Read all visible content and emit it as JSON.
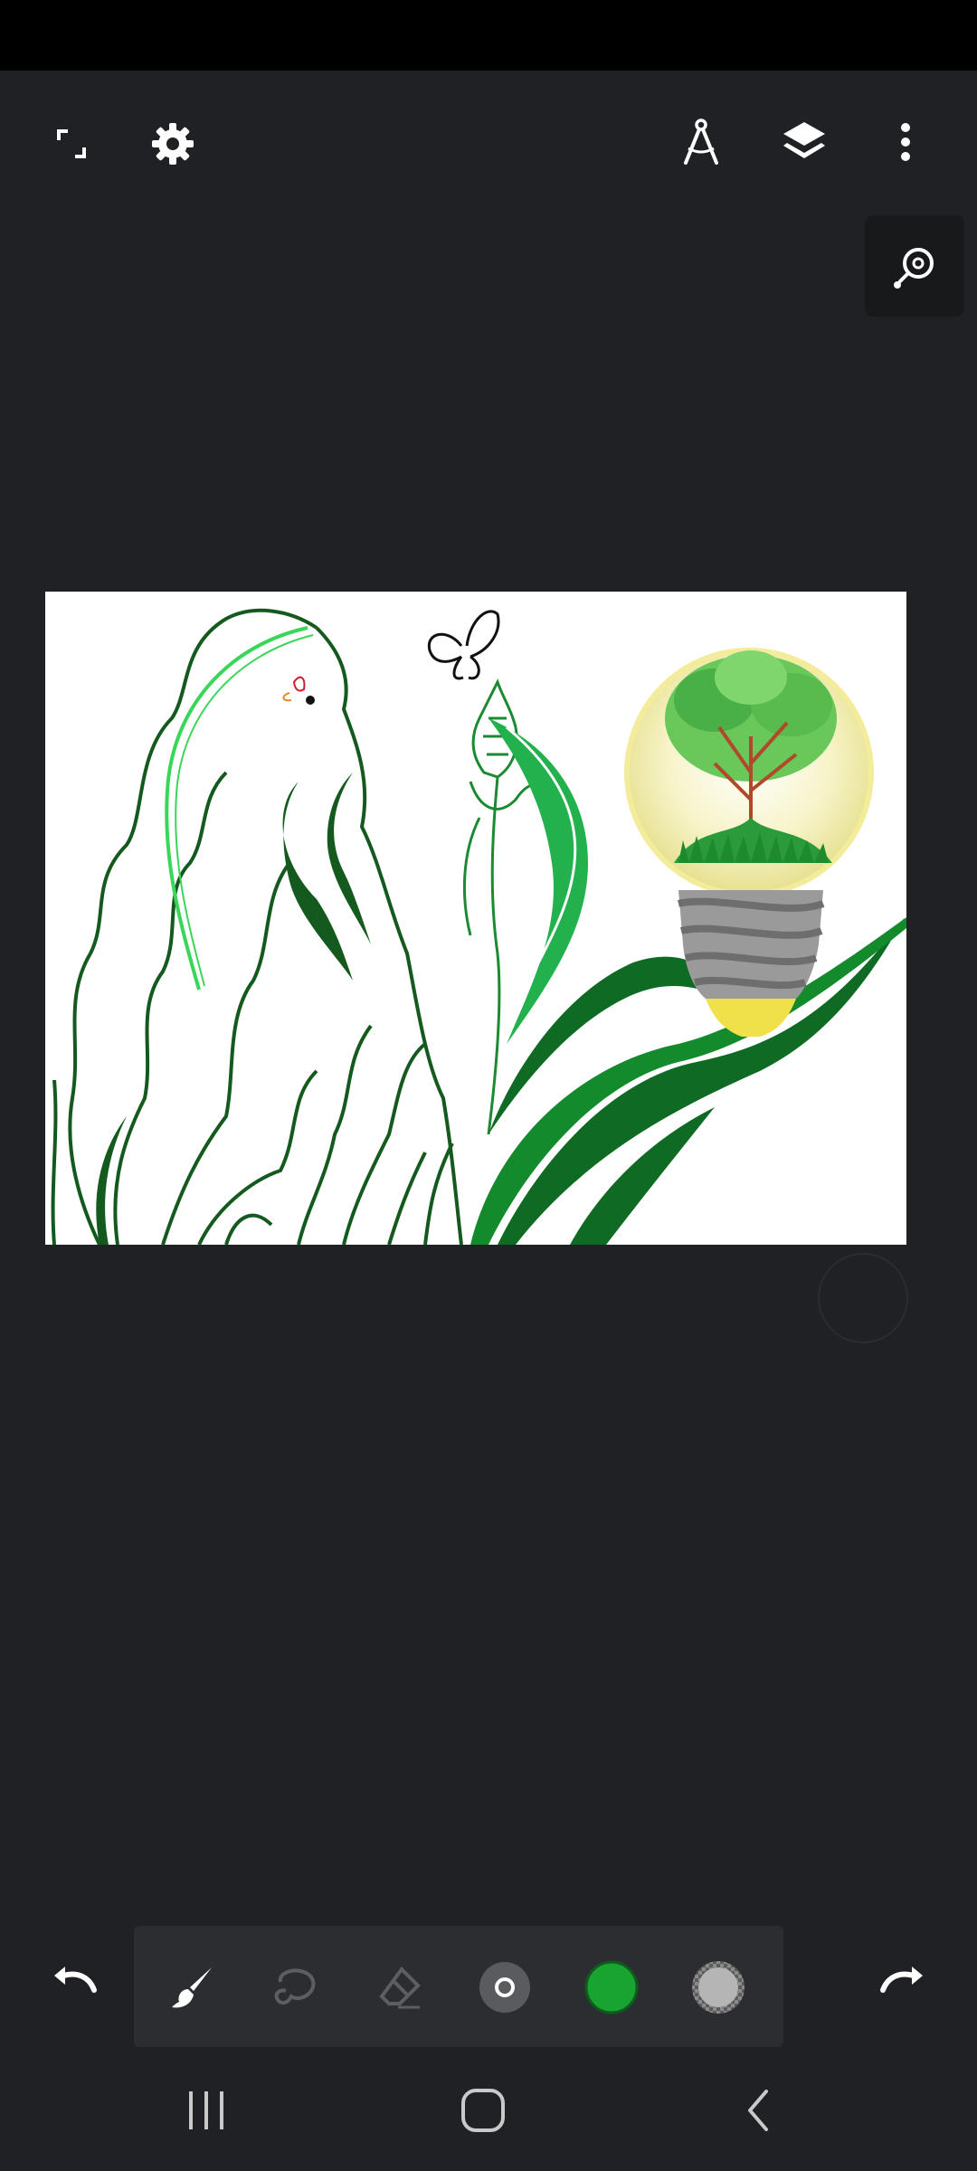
{
  "toolbar_top": {
    "left_icons": [
      "fullscreen-icon",
      "settings-gear-icon"
    ],
    "right_icons": [
      "ruler-compass-icon",
      "layers-icon",
      "more-vertical-icon"
    ]
  },
  "zoom_tool": {
    "icon": "zoom-search-icon"
  },
  "canvas": {
    "background": "#ffffff",
    "artwork": "drawing"
  },
  "brush_bar": {
    "tools": [
      "brush-icon",
      "lasso-icon",
      "eraser-icon",
      "brush-size-icon",
      "color-swatch",
      "opacity-swatch"
    ],
    "active_color": "#19a431",
    "opacity_color": "#b5b5b5"
  },
  "history": {
    "undo_icon": "undo-icon",
    "redo_icon": "redo-icon"
  },
  "system_nav": {
    "icons": [
      "recent-apps-icon",
      "home-icon",
      "back-icon"
    ]
  },
  "colors": {
    "app_background": "#202124",
    "panel": "#2c2d30",
    "status_bar": "#000000",
    "leaf_dark": "#0f6b23",
    "leaf_light": "#22b14c",
    "bulb_yellow": "#f0e04a",
    "bulb_grey": "#9a9a9a"
  }
}
